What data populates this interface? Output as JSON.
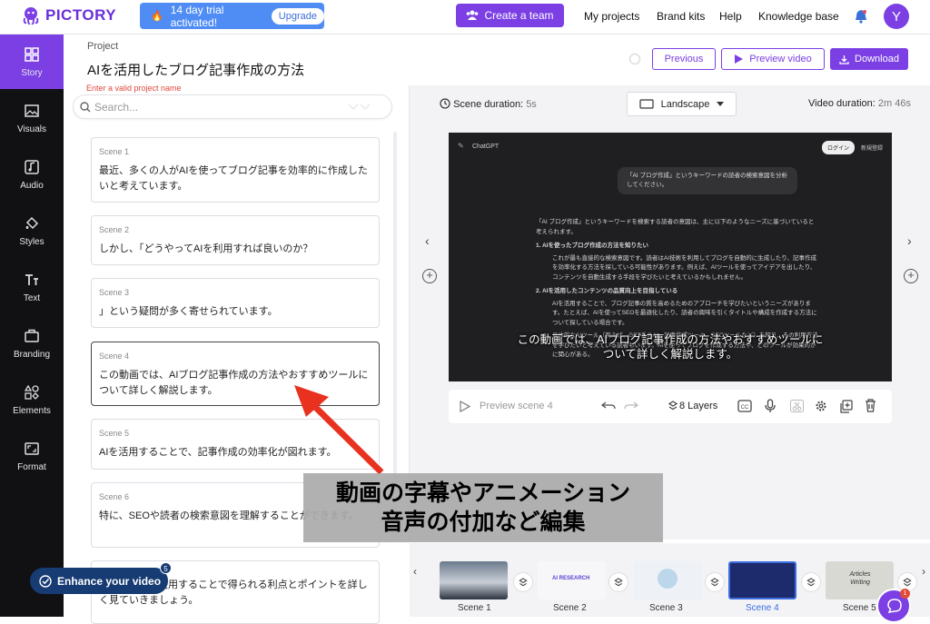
{
  "topbar": {
    "logo": "PICTORY",
    "trial_text": "14 day trial activated!",
    "upgrade_label": "Upgrade",
    "create_team_label": "Create a team",
    "nav": [
      "My projects",
      "Brand kits",
      "Help",
      "Knowledge base"
    ],
    "avatar_letter": "Y",
    "accent_color": "#7b3fe4"
  },
  "sidebar": {
    "items": [
      {
        "label": "Story",
        "icon": "grid-icon"
      },
      {
        "label": "Visuals",
        "icon": "image-icon"
      },
      {
        "label": "Audio",
        "icon": "music-icon"
      },
      {
        "label": "Styles",
        "icon": "paint-bucket-icon"
      },
      {
        "label": "Text",
        "icon": "text-icon"
      },
      {
        "label": "Branding",
        "icon": "briefcase-icon"
      },
      {
        "label": "Elements",
        "icon": "shapes-icon"
      },
      {
        "label": "Format",
        "icon": "aspect-icon"
      }
    ]
  },
  "project": {
    "label": "Project",
    "title": "AIを活用したブログ記事作成の方法",
    "error": "Enter a valid project name"
  },
  "search": {
    "placeholder": "Search..."
  },
  "scenes": [
    {
      "num": "Scene 1",
      "text": "最近、多くの人がAIを使ってブログ記事を効率的に作成したいと考えています。"
    },
    {
      "num": "Scene 2",
      "text": "しかし、「どうやってAIを利用すれば良いのか？"
    },
    {
      "num": "Scene 3",
      "text": "」という疑問が多く寄せられています。"
    },
    {
      "num": "Scene 4",
      "text": "この動画では、AIブログ記事作成の方法やおすすめツールについて詳しく解説します。"
    },
    {
      "num": "Scene 5",
      "text": "AIを活用することで、記事作成の効率化が図れます。"
    },
    {
      "num": "Scene 6",
      "text": "特に、SEOや読者の検索意図を理解することができます。"
    },
    {
      "num": "",
      "text": "ここで、AIを使用することで得られる利点とポイントを詳しく見ていきましょう。"
    }
  ],
  "header_buttons": {
    "previous": "Previous",
    "preview": "Preview video",
    "download": "Download"
  },
  "meta": {
    "scene_duration_label": "Scene duration:",
    "scene_duration": "5s",
    "orientation": "Landscape",
    "video_duration_label": "Video duration:",
    "video_duration": "2m 46s"
  },
  "video": {
    "app_label": "ChatGPT",
    "login": "ログイン",
    "signup": "新規登録",
    "prompt": "「AI ブログ作成」というキーワードの読者の検索意図を分析してください。",
    "intro": "「AI ブログ作成」というキーワードを検索する読者の意図は、主に以下のようなニーズに基づいていると考えられます。",
    "h1": "1. AIを使ったブログ作成の方法を知りたい",
    "p1": "これが最も直接的な検索意図です。読者はAI技術を利用してブログを自動的に生成したり、記事作成を効率化する方法を探している可能性があります。例えば、AIツールを使ってアイデアを出したり、コンテンツを自動生成する手段を学びたいと考えているかもしれません。",
    "h2": "2. AIを活用したコンテンツの品質向上を目指している",
    "p2": "AIを活用することで、ブログ記事の質を高めるためのアプローチを学びたいというニーズがあります。たとえば、AIを使ってSEOを最適化したり、読者の興味を引くタイトルや構成を作成する方法について探している場合です。",
    "p3": "具体的なAIツール（例えば、GPT系のAI、記事作成ツール、SEOツールなど）を知り、その利用方法を学びたいと考えている読者もいます。AIを使ってブログを作成する方法や、どのツールが効果的かに関心がある。",
    "subtitle_line1": "この動画では、AIブログ記事作成の方法やおすすめツールに",
    "subtitle_line2": "ついて詳しく解説します。"
  },
  "player": {
    "preview_label": "Preview scene 4",
    "layers_label": "8 Layers"
  },
  "timeline": {
    "scenes": [
      "Scene 1",
      "Scene 2",
      "Scene 3",
      "Scene 4",
      "Scene 5"
    ],
    "thumb2_text": "AI RESEARCH",
    "thumb5_text": "Articles Writing"
  },
  "enhance": {
    "label": "Enhance your video",
    "badge": "5"
  },
  "chat_badge": "1",
  "overlay": {
    "line1": "動画の字幕やアニメーション",
    "line2": "音声の付加など編集"
  }
}
